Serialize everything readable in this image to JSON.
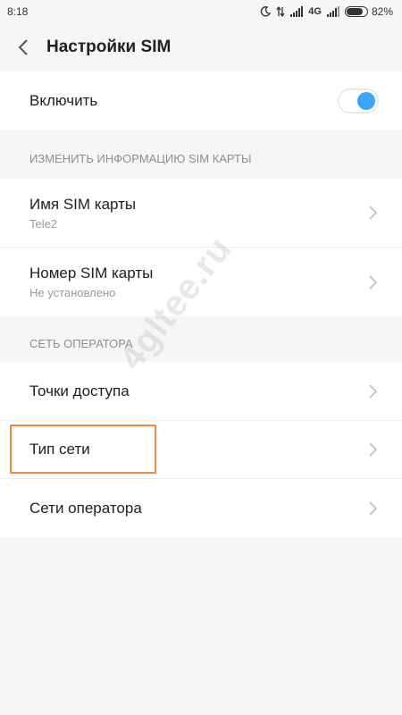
{
  "status_bar": {
    "time": "8:18",
    "network_type": "4G",
    "battery_percent": "82%",
    "battery_level": 0.82
  },
  "header": {
    "title": "Настройки SIM"
  },
  "enable": {
    "label": "Включить",
    "toggle_on": true
  },
  "sections": {
    "sim_info_header": "ИЗМЕНИТЬ ИНФОРМАЦИЮ SIM КАРТЫ",
    "operator_header": "СЕТЬ ОПЕРАТОРА"
  },
  "sim_info": {
    "name_title": "Имя SIM карты",
    "name_value": "Tele2",
    "number_title": "Номер SIM карты",
    "number_value": "Не установлено"
  },
  "operator": {
    "access_points": "Точки доступа",
    "network_type": "Тип сети",
    "operators": "Сети оператора"
  },
  "watermark": "4gltee.ru",
  "colors": {
    "accent": "#3da5f5",
    "highlight": "#f08c3c"
  }
}
